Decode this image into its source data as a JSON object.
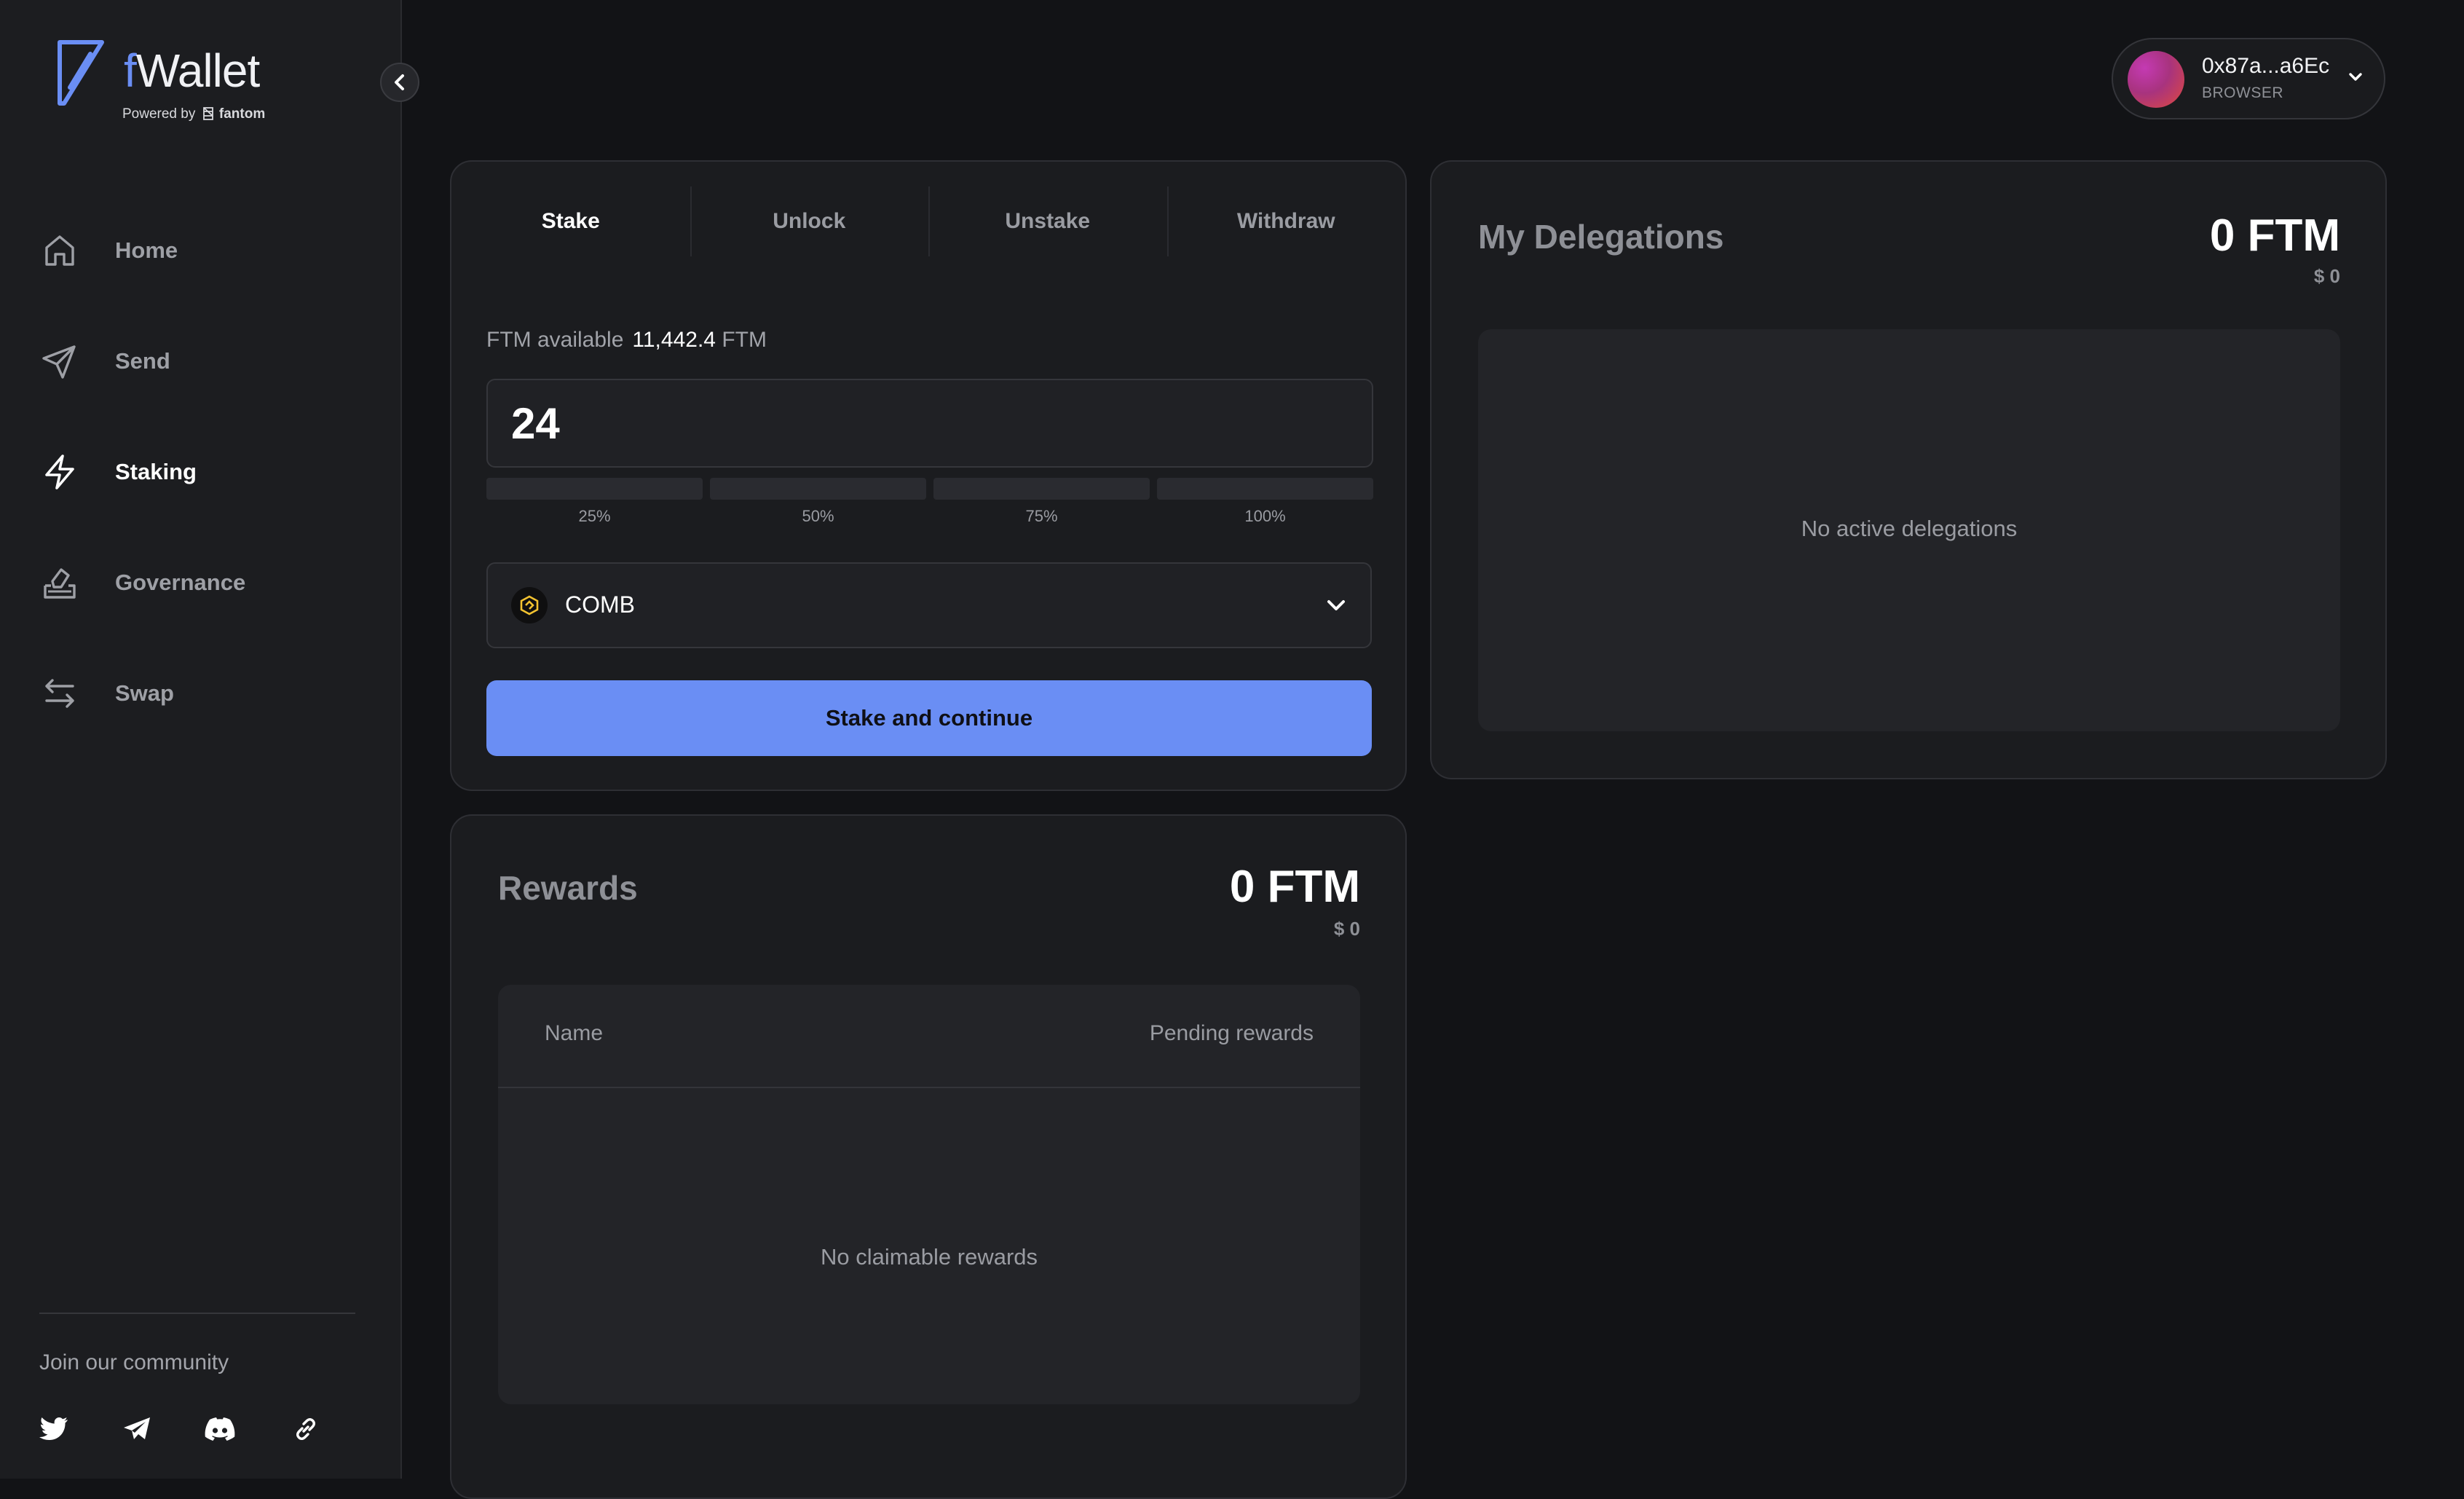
{
  "app": {
    "logo_f": "f",
    "logo_rest": "Wallet",
    "powered_by": "Powered by",
    "fantom": "fantom"
  },
  "sidebar": {
    "items": [
      {
        "label": "Home",
        "icon": "home-icon"
      },
      {
        "label": "Send",
        "icon": "send-icon"
      },
      {
        "label": "Staking",
        "icon": "lightning-icon",
        "active": true
      },
      {
        "label": "Governance",
        "icon": "ballot-box-icon"
      },
      {
        "label": "Swap",
        "icon": "swap-arrows-icon"
      }
    ],
    "community_title": "Join our community",
    "socials": [
      "twitter-icon",
      "telegram-icon",
      "discord-icon",
      "link-icon"
    ]
  },
  "wallet": {
    "address": "0x87a...a6Ec",
    "type": "BROWSER"
  },
  "stake": {
    "tabs": [
      "Stake",
      "Unlock",
      "Unstake",
      "Withdraw"
    ],
    "active_tab": "Stake",
    "available_label": "FTM available",
    "available_value": "11,442.4",
    "available_unit": "FTM",
    "amount_value": "24",
    "percent_options": [
      "25%",
      "50%",
      "75%",
      "100%"
    ],
    "validator_name": "COMB",
    "button_label": "Stake and continue"
  },
  "delegations": {
    "title": "My Delegations",
    "amount": "0 FTM",
    "usd": "$ 0",
    "empty_text": "No active delegations"
  },
  "rewards": {
    "title": "Rewards",
    "amount": "0 FTM",
    "usd": "$ 0",
    "columns": [
      "Name",
      "Pending rewards"
    ],
    "empty_text": "No claimable rewards"
  },
  "colors": {
    "accent": "#6a8ef4",
    "background": "#121316",
    "sidebar": "#1c1d20",
    "card": "#1b1c1f"
  }
}
